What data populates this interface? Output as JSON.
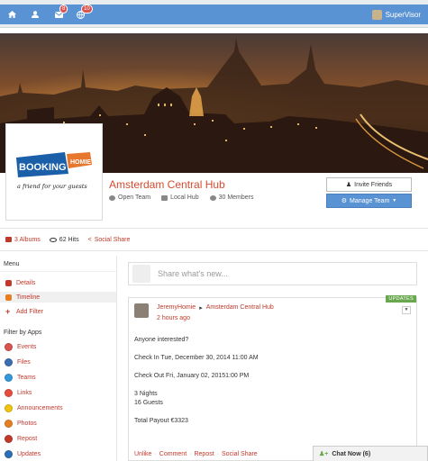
{
  "topbar": {
    "messages_badge": "8",
    "notifications_badge": "10",
    "user_name": "SuperVisor"
  },
  "group": {
    "title": "Amsterdam Central Hub",
    "type": "Open Team",
    "hub": "Local Hub",
    "members": "30 Members",
    "invite_label": "Invite Friends",
    "manage_label": "Manage Team"
  },
  "logo": {
    "word1": "BOOKING",
    "word2": "HOMIE",
    "tagline": "a friend for your guests"
  },
  "stats": {
    "albums": "3 Albums",
    "hits": "62 Hits",
    "social": "Social Share"
  },
  "sidebar": {
    "menu_heading": "Menu",
    "menu_items": [
      {
        "label": "Details",
        "color": "#c0392b"
      },
      {
        "label": "Timeline",
        "color": "#e67e22"
      },
      {
        "label": "Add Filter",
        "color": "#c0392b"
      }
    ],
    "apps_heading": "Filter by Apps",
    "apps": [
      {
        "label": "Events",
        "color": "#d9534f"
      },
      {
        "label": "Files",
        "color": "#3b6db3"
      },
      {
        "label": "Teams",
        "color": "#3498db"
      },
      {
        "label": "Links",
        "color": "#e74c3c"
      },
      {
        "label": "Announcements",
        "color": "#f1c40f"
      },
      {
        "label": "Photos",
        "color": "#e67e22"
      },
      {
        "label": "Repost",
        "color": "#c0392b"
      },
      {
        "label": "Updates",
        "color": "#2c6fb5"
      }
    ]
  },
  "share": {
    "placeholder": "Share what's new..."
  },
  "post": {
    "badge": "UPDATES",
    "author": "JeremyHomie",
    "target": "Amsterdam Central Hub",
    "time": "2 hours ago",
    "lines": [
      "Anyone interested?",
      "",
      "Check In Tue, December 30, 2014 11:00 AM",
      "",
      "Check Out Fri, January 02, 20151:00 PM",
      "",
      "3 Nights",
      "16 Guests",
      "",
      "Total Payout €3323"
    ],
    "actions": [
      "Unlike",
      "Comment",
      "Repost",
      "Social Share"
    ],
    "action_separator": "·"
  },
  "chat": {
    "label": "Chat Now (6)"
  },
  "colors": {
    "accent": "#5a93d3",
    "link": "#c0392b",
    "title": "#d44b2f",
    "badge_green": "#6aa84f"
  }
}
